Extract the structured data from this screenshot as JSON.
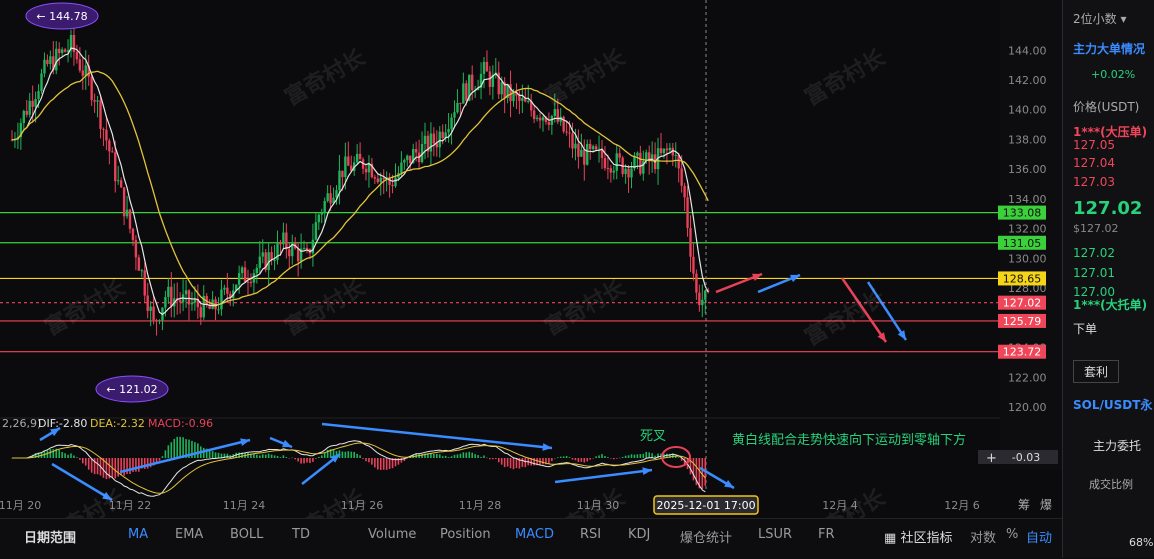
{
  "chart_data": {
    "type": "candlestick",
    "y_axis_ticks": [
      "144.00",
      "142.00",
      "140.00",
      "138.00",
      "136.00",
      "134.00",
      "132.00",
      "130.00",
      "128.00",
      "126.00",
      "124.00",
      "122.00",
      "120.00"
    ],
    "ylim": [
      120,
      145.5
    ],
    "x_axis_ticks": [
      "11月 20",
      "11月 22",
      "11月 24",
      "11月 26",
      "11月 28",
      "11月 30",
      "12月 4",
      "12月 6"
    ],
    "crosshair_label": "2025-12-01 17:00",
    "max_label": "144.78",
    "min_label": "121.02",
    "price_levels": [
      {
        "value": 133.08,
        "label": "133.08",
        "color": "#3bd13b"
      },
      {
        "value": 131.05,
        "label": "131.05",
        "color": "#3bd13b"
      },
      {
        "value": 128.65,
        "label": "128.65",
        "color": "#f5d51a"
      },
      {
        "value": 127.02,
        "label": "127.02",
        "color": "#f0465a"
      },
      {
        "value": 125.79,
        "label": "125.79",
        "color": "#f0465a"
      },
      {
        "value": 123.72,
        "label": "123.72",
        "color": "#f0465a"
      }
    ],
    "close_series": [
      [
        0,
        138
      ],
      [
        3,
        143
      ],
      [
        5,
        144.3
      ],
      [
        7,
        141
      ],
      [
        9,
        135
      ],
      [
        11,
        129
      ],
      [
        12,
        125.5
      ],
      [
        13,
        127.5
      ],
      [
        15,
        127
      ],
      [
        17,
        126.5
      ],
      [
        19,
        128.5
      ],
      [
        21,
        129.5
      ],
      [
        23,
        131
      ],
      [
        25,
        130
      ],
      [
        26,
        133
      ],
      [
        28,
        136
      ],
      [
        30,
        136.5
      ],
      [
        32,
        135
      ],
      [
        34,
        137
      ],
      [
        36,
        138
      ],
      [
        38,
        141
      ],
      [
        40,
        142.5
      ],
      [
        42,
        141
      ],
      [
        44,
        140
      ],
      [
        46,
        139.5
      ],
      [
        48,
        137
      ],
      [
        50,
        136.8
      ],
      [
        52,
        136.2
      ],
      [
        54,
        136.5
      ],
      [
        55,
        136.8
      ],
      [
        56,
        137.5
      ],
      [
        57,
        134
      ],
      [
        58,
        127.5
      ],
      [
        59,
        127.02
      ]
    ],
    "macd": {
      "label": "2,26,9)",
      "dif": "DIF:-2.80",
      "dea": "DEA:-2.32",
      "macd": "MACD:-0.96",
      "zero_label": "-0.03"
    },
    "annotations": {
      "death_cross": "死叉",
      "note": "黄白线配合走势快速向下运动到零轴下方"
    },
    "colors": {
      "up": "#1fb35a",
      "down": "#e8425a",
      "ma_fast": "#e6e6e6",
      "ma_slow": "#e2c33a"
    }
  },
  "sidebar": {
    "decimals": "2位小数",
    "big_order_title": "主力大单情况",
    "change": "+0.02%",
    "price_unit": "价格(USDT)",
    "ask_big": "1***(大压单)",
    "asks": [
      "127.05",
      "127.04",
      "127.03"
    ],
    "last_price": "127.02",
    "last_price_sub": "$127.02",
    "bids": [
      "127.02",
      "127.01",
      "127.00"
    ],
    "bid_big": "1***(大托单)",
    "order_label": "下单",
    "arbitrage": "套利",
    "pair": "SOL/USDT永",
    "main_order": "主力委托",
    "deal_ratio": "成交比例",
    "pct": "68%"
  },
  "toolbar": {
    "items": [
      "日期范围",
      "MA",
      "EMA",
      "BOLL",
      "TD",
      "Volume",
      "Position",
      "MACD",
      "RSI",
      "KDJ",
      "爆仓统计",
      "LSUR",
      "FR",
      "社区指标",
      "对数",
      "%",
      "自动"
    ],
    "active": [
      "MA",
      "MACD",
      "自动"
    ]
  },
  "watermark": "富奇村长",
  "extra_axis": [
    "筹",
    "爆"
  ]
}
